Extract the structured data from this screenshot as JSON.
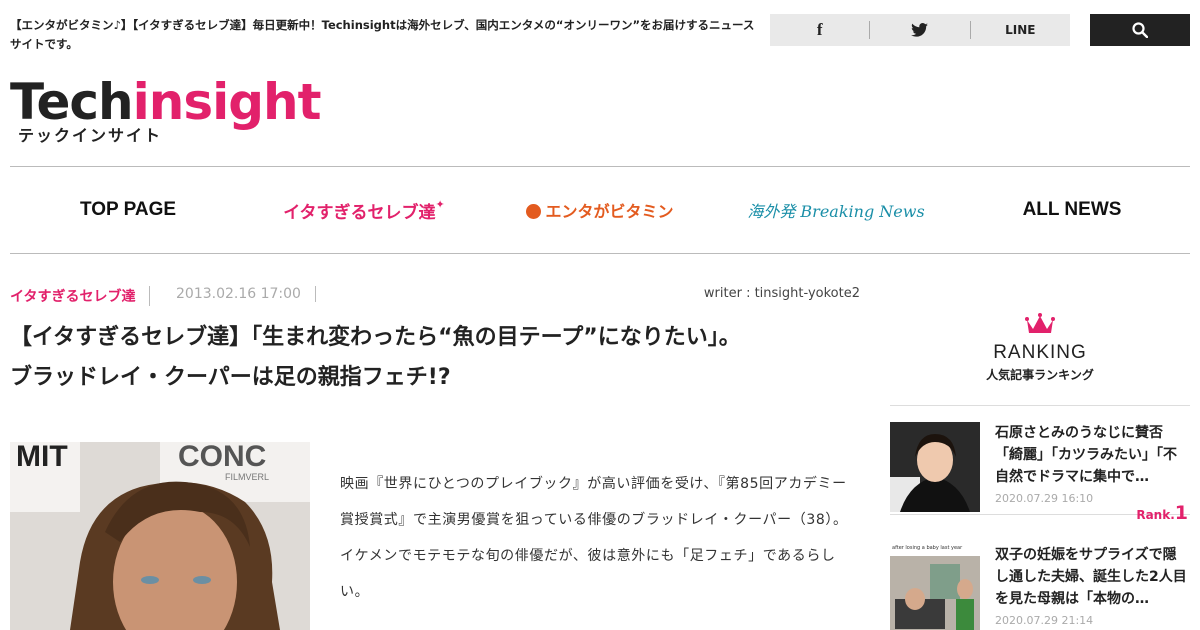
{
  "header": {
    "tagline": "【エンタがビタミン♪】【イタすぎるセレブ達】毎日更新中！Techinsightは海外セレブ、国内エンタメの“オンリーワン”をお届けするニュースサイトです。",
    "share": [
      {
        "label": "f",
        "icon": "facebook-icon"
      },
      {
        "label": "",
        "icon": "twitter-icon"
      },
      {
        "label": "LINE",
        "icon": "line-icon"
      }
    ],
    "search_icon": "search-icon"
  },
  "logo": {
    "word1": "Tech",
    "word2": "insight",
    "kana": "テックインサイト"
  },
  "nav": {
    "items": [
      "TOP PAGE",
      "イタすぎるセレブ達",
      "エンタがビタミン",
      "海外発 Breaking News",
      "ALL NEWS"
    ]
  },
  "article": {
    "category": "イタすぎるセレブ達",
    "date": "2013.02.16 17:00",
    "writer": "writer : tinsight-yokote2",
    "headline_line1": "【イタすぎるセレブ達】「生まれ変わったら“魚の目テープ”になりたい」。",
    "headline_line2": "ブラッドレイ・クーパーは足の親指フェチ!?",
    "photo_text1": "MIT",
    "photo_text2": "CONC",
    "photo_text3": "FILMVERL",
    "body": "映画『世界にひとつのプレイブック』が高い評価を受け、『第85回アカデミー賞授賞式』で主演男優賞を狙っている俳優のブラッドレイ・クーパー（38）。イケメンでモテモテな旬の俳優だが、彼は意外にも「足フェチ」であるらしい。"
  },
  "ranking": {
    "title": "RANKING",
    "subtitle": "人気記事ランキング",
    "items": [
      {
        "title": "石原さとみのうなじに賛否「綺麗」「カツラみたい」「不自然でドラマに集中で…",
        "date": "2020.07.29 16:10",
        "rank_prefix": "Rank.",
        "rank_num": "1"
      },
      {
        "title": "双子の妊娠をサプライズで隠し通した夫婦、誕生した2人目を見た母親は「本物の…",
        "date": "2020.07.29 21:14",
        "thumb_caption": "after losing a baby last year"
      }
    ]
  },
  "colors": {
    "accent": "#e2216b",
    "orange": "#e35b1f",
    "teal": "#1b8fa8",
    "dark": "#222222"
  }
}
